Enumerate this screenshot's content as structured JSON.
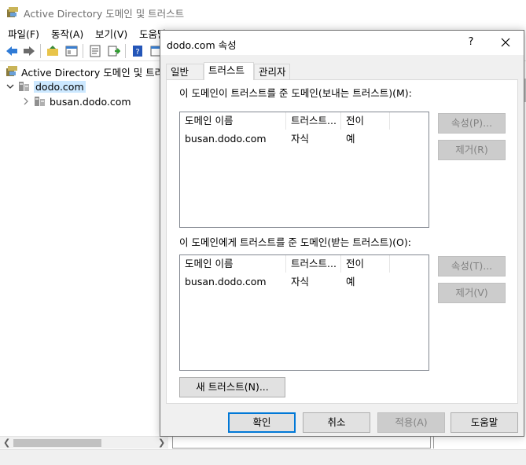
{
  "main_window": {
    "title": "Active Directory 도메인 및 트러스트",
    "menu": [
      "파일(F)",
      "동작(A)",
      "보기(V)",
      "도움말(H)"
    ],
    "tree": {
      "root": "Active Directory 도메인 및 트러스트",
      "domain": "dodo.com",
      "child": "busan.dodo.com"
    }
  },
  "dialog": {
    "title": "dodo.com 속성",
    "help_label": "?",
    "tabs": [
      "일반",
      "트러스트",
      "관리자"
    ],
    "active_tab": "트러스트",
    "outgoing": {
      "label": "이 도메인이 트러스트를 준 도메인(보내는 트러스트)(M):",
      "columns": [
        "도메인 이름",
        "트러스트...",
        "전이"
      ],
      "rows": [
        {
          "domain": "busan.dodo.com",
          "trust": "자식",
          "transitive": "예"
        }
      ],
      "properties_button": "속성(P)...",
      "remove_button": "제거(R)"
    },
    "incoming": {
      "label": "이 도메인에게 트러스트를 준 도메인(받는 트러스트)(O):",
      "columns": [
        "도메인 이름",
        "트러스트...",
        "전이"
      ],
      "rows": [
        {
          "domain": "busan.dodo.com",
          "trust": "자식",
          "transitive": "예"
        }
      ],
      "properties_button": "속성(T)...",
      "remove_button": "제거(V)"
    },
    "new_trust_button": "새 트러스트(N)...",
    "footer": {
      "ok": "확인",
      "cancel": "취소",
      "apply": "적용(A)",
      "help": "도움말"
    }
  },
  "colors": {
    "accent": "#0078d7",
    "selection": "#cce8ff",
    "dialog_bg": "#f0f0f0"
  }
}
